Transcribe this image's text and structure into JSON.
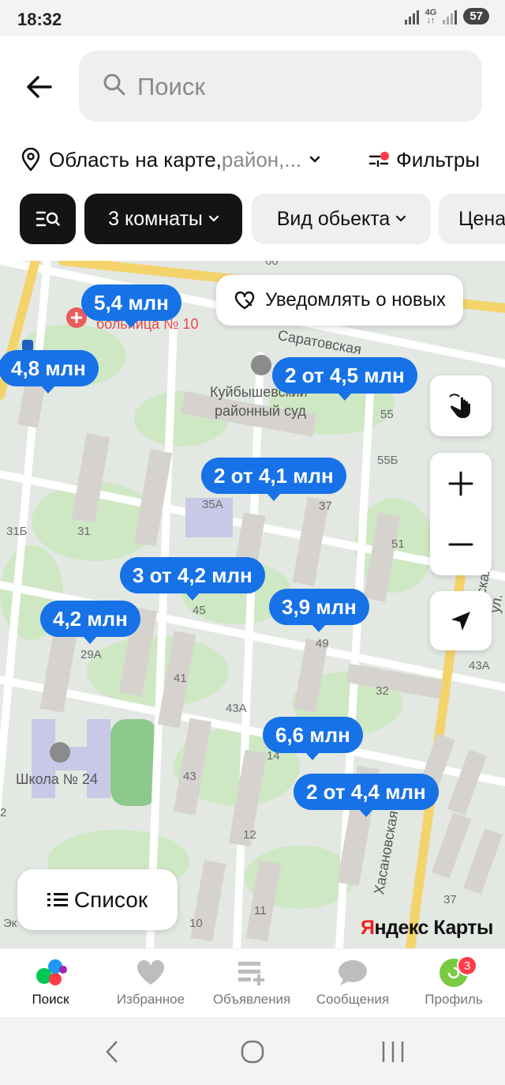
{
  "status": {
    "time": "18:32",
    "network": "4G",
    "battery": "57"
  },
  "search": {
    "placeholder": "Поиск"
  },
  "area": {
    "label": "Область на карте,",
    "muted": " район,..."
  },
  "filters": {
    "label": "Фильтры"
  },
  "chips": [
    {
      "label": ""
    },
    {
      "label": "3 комнаты"
    },
    {
      "label": "Вид обьекта"
    },
    {
      "label": "Цена"
    }
  ],
  "map": {
    "notify_label": "Уведомлять о новых",
    "pins": [
      "5,4 млн",
      "4,8 млн",
      "2 от 4,5 млн",
      "2 от 4,1 млн",
      "3 от 4,2 млн",
      "4,2 млн",
      "3,9 млн",
      "6,6 млн",
      "2 от 4,4 млн"
    ],
    "labels": {
      "hospital": "больница № 10",
      "court1": "Куйбышевский",
      "court2": "районный суд",
      "street1": "Саратовская",
      "street2": "Хасановская",
      "street3": "овская ул.",
      "school": "Школа № 24",
      "n60": "60",
      "n55": "55",
      "n55b": "55Б",
      "n35a": "35А",
      "n37": "37",
      "n51": "51",
      "n31b": "31Б",
      "n31": "31",
      "n45": "45",
      "n49": "49",
      "n29a": "29А",
      "n41": "41",
      "n43a": "43А",
      "n43a2": "43А",
      "n32": "32",
      "n43": "43",
      "n14": "14",
      "n12": "12",
      "n11": "11",
      "n10": "10",
      "n37b": "37",
      "n2": "2",
      "ek": "Эк"
    },
    "list_label": "Список",
    "brand_y": "Я",
    "brand_rest": "ндекс Карты"
  },
  "nav": [
    {
      "label": "Поиск"
    },
    {
      "label": "Избранное"
    },
    {
      "label": "Объявления"
    },
    {
      "label": "Сообщения"
    },
    {
      "label": "Профиль",
      "badge": "3"
    }
  ],
  "colors": {
    "pin": "#1672e6",
    "dark_chip": "#141414",
    "badge": "#ff3b4a"
  }
}
